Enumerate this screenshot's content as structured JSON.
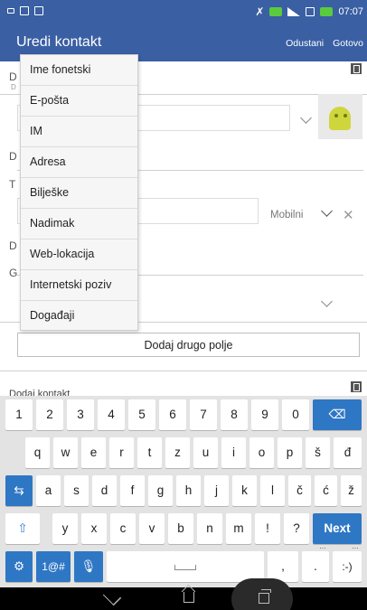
{
  "status": {
    "time": "07:07"
  },
  "appbar": {
    "title": "Uredi kontakt",
    "cancel_label": "Odustani",
    "done_label": "Gotovo"
  },
  "form": {
    "section_letters": [
      "D",
      "D",
      "T",
      "D",
      "G"
    ],
    "section_tiny": "D",
    "phone_type": "Mobilni",
    "add_field_label": "Dodaj drugo polje",
    "bottom_cut_text": "Dodaj kontakt"
  },
  "menu": {
    "items": [
      "Ime fonetski",
      "E-pošta",
      "IM",
      "Adresa",
      "Bilješke",
      "Nadimak",
      "Web-lokacija",
      "Internetski poziv",
      "Događaji"
    ]
  },
  "keyboard": {
    "row1": [
      "1",
      "2",
      "3",
      "4",
      "5",
      "6",
      "7",
      "8",
      "9",
      "0"
    ],
    "row2": [
      "q",
      "w",
      "e",
      "r",
      "t",
      "z",
      "u",
      "i",
      "o",
      "p",
      "š",
      "đ"
    ],
    "row3": [
      "a",
      "s",
      "d",
      "f",
      "g",
      "h",
      "j",
      "k",
      "l",
      "č",
      "ć",
      "ž"
    ],
    "row4": [
      "y",
      "x",
      "c",
      "v",
      "b",
      "n",
      "m",
      "!",
      "?"
    ],
    "next_label": "Next",
    "symbols_label": "1@#",
    "comma": ",",
    "period": ".",
    "smiley": ":-)"
  },
  "colors": {
    "accent": "#3a5fa3",
    "key_blue": "#2e77c4",
    "battery_green": "#5acb3c"
  }
}
